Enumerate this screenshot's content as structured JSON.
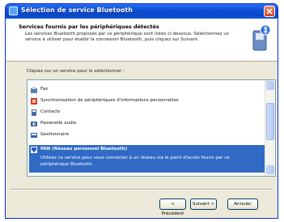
{
  "window": {
    "title": "Sélection de service Bluetooth"
  },
  "header": {
    "title": "Services fournis par les périphériques détectés",
    "description": "Les services Bluetooth proposés par ce périphérique sont listés ci-dessous. Sélectionnez un service à utiliser pour établir la connexion Bluetooth, puis cliquez sur Suivant."
  },
  "instruction": "Cliquez sur un service pour le sélectionner :",
  "services": [
    {
      "label": "Fax",
      "icon": "fax-icon",
      "color": "#5a7fb8"
    },
    {
      "label": "Synchronisation de périphériques d'informations personnelles",
      "icon": "sync-icon",
      "color": "#d04020"
    },
    {
      "label": "Contacts",
      "icon": "contacts-icon",
      "color": "#4a6aa0"
    },
    {
      "label": "Passerelle audio",
      "icon": "audio-icon",
      "color": "#3a5a90"
    },
    {
      "label": "Gestionnaire",
      "icon": "manager-icon",
      "color": "#2a60c0"
    }
  ],
  "selected_service": {
    "label": "PAN (Réseau personnel Bluetooth)",
    "icon": "network-icon",
    "description": "Utilisez ce service pour vous connecter à un réseau via le point d'accès fourni par ce périphérique Bluetooth."
  },
  "buttons": {
    "back": "< Précédent",
    "next": "Suivant >",
    "cancel": "Annuler"
  },
  "colors": {
    "selection": "#316ac5",
    "titlebar": "#0a4fd4"
  }
}
